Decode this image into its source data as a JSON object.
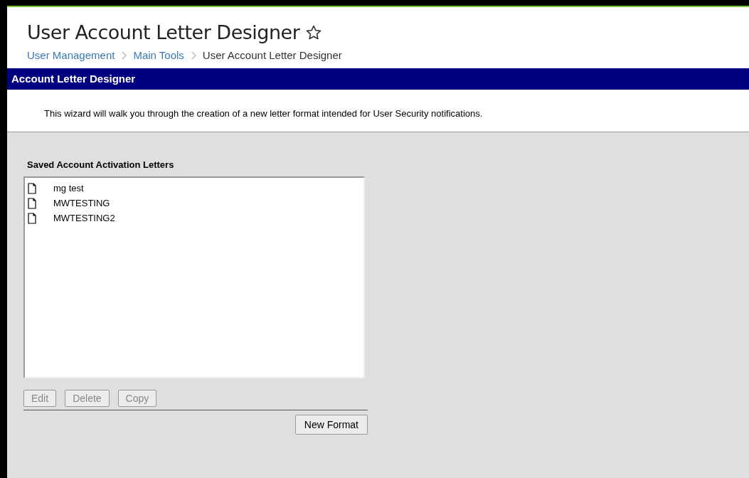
{
  "page": {
    "title": "User Account Letter Designer",
    "favorite": false
  },
  "breadcrumb": [
    {
      "label": "User Management",
      "kind": "link"
    },
    {
      "label": "Main Tools",
      "kind": "link"
    },
    {
      "label": "User Account Letter Designer",
      "kind": "current"
    }
  ],
  "panel": {
    "title": "Account Letter Designer",
    "description": "This wizard will walk you through the creation of a new letter format intended for User Security notifications."
  },
  "letters": {
    "label": "Saved Account Activation Letters",
    "items": [
      {
        "name": "mg test"
      },
      {
        "name": "MWTESTING"
      },
      {
        "name": "MWTESTING2"
      }
    ]
  },
  "actions": [
    {
      "label": "Edit",
      "disabled": true
    },
    {
      "label": "Delete",
      "disabled": true
    },
    {
      "label": "Copy",
      "disabled": true
    }
  ],
  "new_button": {
    "label": "New Format"
  }
}
